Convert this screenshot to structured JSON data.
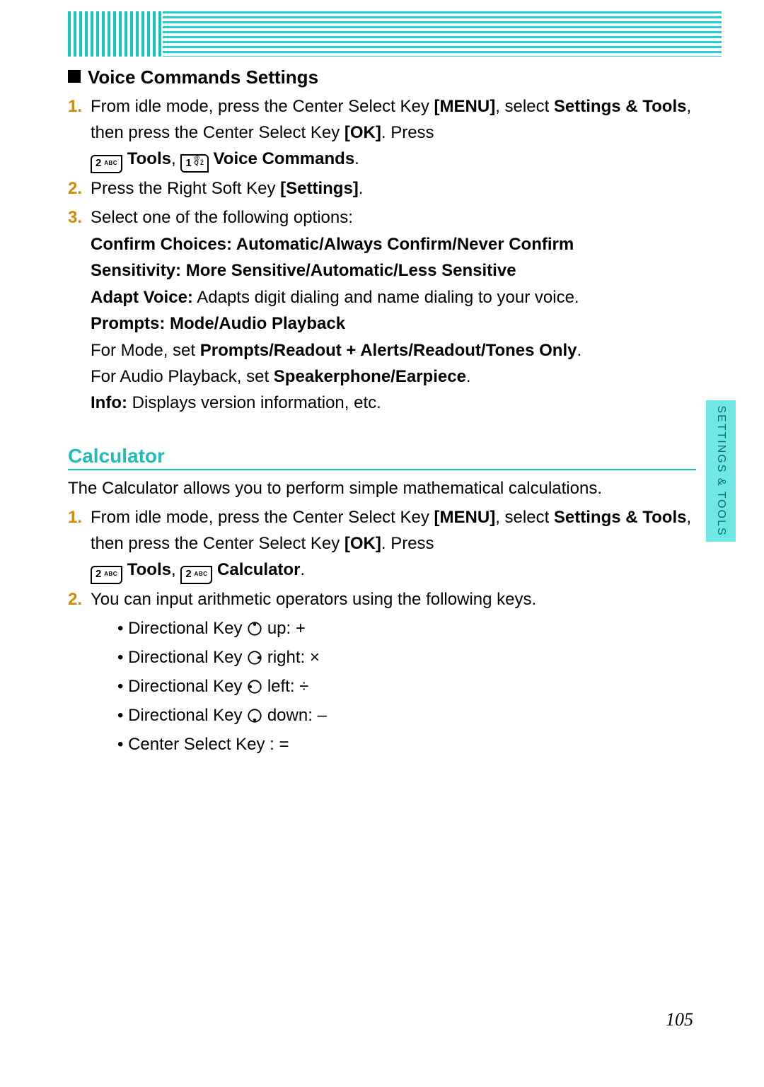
{
  "side_label": "SETTINGS & TOOLS",
  "page_number": "105",
  "sec1": {
    "heading": "Voice Commands Settings",
    "step1": {
      "num": "1.",
      "a": "From idle mode, press the Center Select Key ",
      "b": "[MENU]",
      "c": ", select ",
      "d": "Settings & Tools",
      "e": ", then press the Center Select Key ",
      "f": "[OK]",
      "g": ". Press ",
      "h": " Tools",
      "i": ", ",
      "j": " Voice Commands",
      "k": "."
    },
    "step2": {
      "num": "2.",
      "a": "Press the Right Soft Key ",
      "b": "[Settings]",
      "c": "."
    },
    "step3": {
      "num": "3.",
      "a": "Select one of the following options:"
    },
    "opts": {
      "l1": "Confirm Choices: Automatic/Always Confirm/Never Confirm",
      "l2": "Sensitivity: More Sensitive/Automatic/Less Sensitive",
      "l3a": "Adapt Voice:",
      "l3b": " Adapts digit dialing and name dialing to your voice.",
      "l4": "Prompts: Mode/Audio Playback",
      "l5a": "For Mode, set ",
      "l5b": "Prompts/Readout + Alerts/Readout/Tones Only",
      "l5c": ".",
      "l6a": "For Audio Playback, set ",
      "l6b": "Speakerphone/Earpiece",
      "l6c": ".",
      "l7a": "Info:",
      "l7b": " Displays version information, etc."
    }
  },
  "sec2": {
    "heading": "Calculator",
    "intro": "The Calculator allows you to perform simple mathematical calculations.",
    "step1": {
      "num": "1.",
      "a": "From idle mode, press the Center Select Key ",
      "b": "[MENU]",
      "c": ", select ",
      "d": "Settings & Tools",
      "e": ", then press the Center Select Key ",
      "f": "[OK]",
      "g": ". Press ",
      "h": " Tools",
      "i": ", ",
      "j": " Calculator",
      "k": "."
    },
    "step2": {
      "num": "2.",
      "a": "You can input arithmetic operators using the following keys."
    },
    "bullets": {
      "b1a": "Directional Key ",
      "b1b": " up: +",
      "b2a": "Directional Key ",
      "b2b": " right: ×",
      "b3a": "Directional Key ",
      "b3b": " left: ÷",
      "b4a": "Directional Key ",
      "b4b": " down: –",
      "b5": "Center Select Key : ="
    }
  },
  "keys": {
    "k2_big": "2",
    "k2_sm": "ABC",
    "k1_big": "1",
    "k1_sm_a": "@ .",
    "k1_sm_b": "Q Z"
  }
}
